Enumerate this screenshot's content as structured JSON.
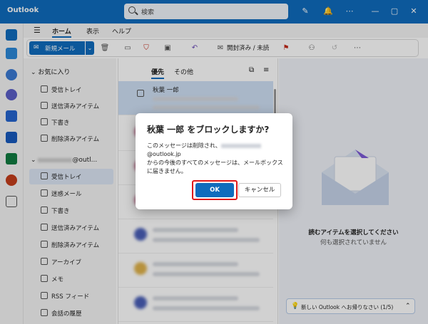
{
  "titlebar": {
    "app_title": "Outlook",
    "search_placeholder": "検索"
  },
  "ribbon": {
    "tabs": [
      "ホーム",
      "表示",
      "ヘルプ"
    ],
    "new_mail": "新規メール",
    "mark_read": "開封済み / 未読"
  },
  "folders": {
    "favorites_header": "お気に入り",
    "favorites": [
      "受信トレイ",
      "送信済みアイテム",
      "下書き",
      "削除済みアイテム"
    ],
    "account_header": "@outl...",
    "account_folders": [
      "受信トレイ",
      "迷惑メール",
      "下書き",
      "送信済みアイテム",
      "削除済みアイテム",
      "アーカイブ",
      "メモ",
      "RSS フィード",
      "会話の履歴"
    ]
  },
  "message_list": {
    "tab_focused": "優先",
    "tab_other": "その他",
    "first_sender": "秋葉 一郎"
  },
  "reading_pane": {
    "empty_title": "読むアイテムを選択してください",
    "empty_subtitle": "何も選択されていません",
    "tip": "新しい Outlook へお帰りなさい (1/5)"
  },
  "dialog": {
    "title": "秋葉 一郎 をブロックしますか?",
    "body_1": "このメッセージは削除され、",
    "body_email": "@outlook.jp",
    "body_2": "からの今後のすべてのメッセージは、メールボックスに届きません。",
    "ok": "OK",
    "cancel": "キャンセル"
  },
  "colors": {
    "brand": "#0f6cbd",
    "highlight": "#e01818"
  }
}
